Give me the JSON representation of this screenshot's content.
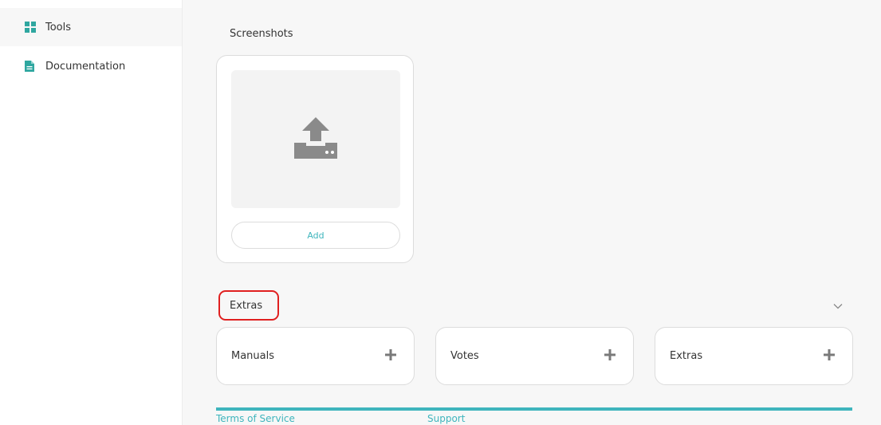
{
  "sidebar": {
    "items": [
      {
        "label": "Tools",
        "icon": "grid-icon",
        "active": true
      },
      {
        "label": "Documentation",
        "icon": "document-icon",
        "active": false
      }
    ]
  },
  "screenshots": {
    "title": "Screenshots",
    "upload_icon": "upload-icon",
    "add_label": "Add"
  },
  "extras": {
    "title": "Extras",
    "cards": [
      {
        "label": "Manuals",
        "icon": "plus-icon"
      },
      {
        "label": "Votes",
        "icon": "plus-icon"
      },
      {
        "label": "Extras",
        "icon": "plus-icon"
      }
    ]
  },
  "footer": {
    "links": [
      "Terms of Service",
      "Support"
    ]
  },
  "colors": {
    "accent": "#3fb5bd",
    "highlight": "#e02020",
    "icon_teal": "#2fa7a0",
    "icon_gray": "#8a8a8a"
  }
}
